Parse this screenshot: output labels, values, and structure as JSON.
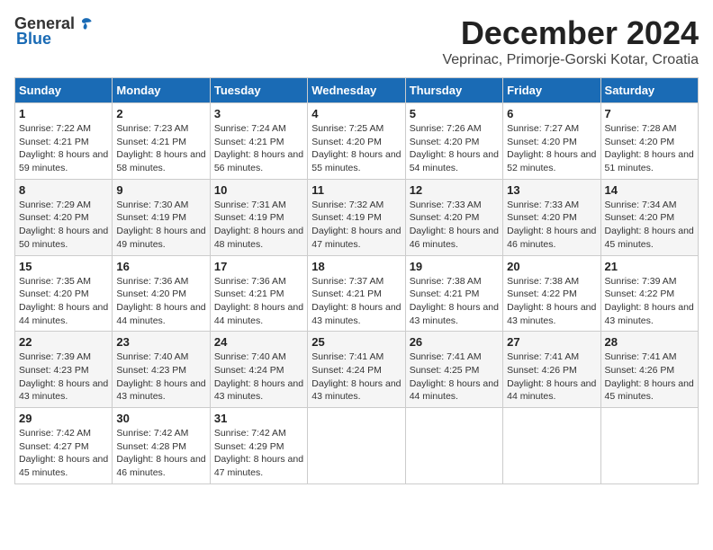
{
  "logo": {
    "general": "General",
    "blue": "Blue"
  },
  "title": "December 2024",
  "subtitle": "Veprinac, Primorje-Gorski Kotar, Croatia",
  "weekdays": [
    "Sunday",
    "Monday",
    "Tuesday",
    "Wednesday",
    "Thursday",
    "Friday",
    "Saturday"
  ],
  "weeks": [
    [
      {
        "day": "1",
        "sunrise": "7:22 AM",
        "sunset": "4:21 PM",
        "daylight": "8 hours and 59 minutes."
      },
      {
        "day": "2",
        "sunrise": "7:23 AM",
        "sunset": "4:21 PM",
        "daylight": "8 hours and 58 minutes."
      },
      {
        "day": "3",
        "sunrise": "7:24 AM",
        "sunset": "4:21 PM",
        "daylight": "8 hours and 56 minutes."
      },
      {
        "day": "4",
        "sunrise": "7:25 AM",
        "sunset": "4:20 PM",
        "daylight": "8 hours and 55 minutes."
      },
      {
        "day": "5",
        "sunrise": "7:26 AM",
        "sunset": "4:20 PM",
        "daylight": "8 hours and 54 minutes."
      },
      {
        "day": "6",
        "sunrise": "7:27 AM",
        "sunset": "4:20 PM",
        "daylight": "8 hours and 52 minutes."
      },
      {
        "day": "7",
        "sunrise": "7:28 AM",
        "sunset": "4:20 PM",
        "daylight": "8 hours and 51 minutes."
      }
    ],
    [
      {
        "day": "8",
        "sunrise": "7:29 AM",
        "sunset": "4:20 PM",
        "daylight": "8 hours and 50 minutes."
      },
      {
        "day": "9",
        "sunrise": "7:30 AM",
        "sunset": "4:19 PM",
        "daylight": "8 hours and 49 minutes."
      },
      {
        "day": "10",
        "sunrise": "7:31 AM",
        "sunset": "4:19 PM",
        "daylight": "8 hours and 48 minutes."
      },
      {
        "day": "11",
        "sunrise": "7:32 AM",
        "sunset": "4:19 PM",
        "daylight": "8 hours and 47 minutes."
      },
      {
        "day": "12",
        "sunrise": "7:33 AM",
        "sunset": "4:20 PM",
        "daylight": "8 hours and 46 minutes."
      },
      {
        "day": "13",
        "sunrise": "7:33 AM",
        "sunset": "4:20 PM",
        "daylight": "8 hours and 46 minutes."
      },
      {
        "day": "14",
        "sunrise": "7:34 AM",
        "sunset": "4:20 PM",
        "daylight": "8 hours and 45 minutes."
      }
    ],
    [
      {
        "day": "15",
        "sunrise": "7:35 AM",
        "sunset": "4:20 PM",
        "daylight": "8 hours and 44 minutes."
      },
      {
        "day": "16",
        "sunrise": "7:36 AM",
        "sunset": "4:20 PM",
        "daylight": "8 hours and 44 minutes."
      },
      {
        "day": "17",
        "sunrise": "7:36 AM",
        "sunset": "4:21 PM",
        "daylight": "8 hours and 44 minutes."
      },
      {
        "day": "18",
        "sunrise": "7:37 AM",
        "sunset": "4:21 PM",
        "daylight": "8 hours and 43 minutes."
      },
      {
        "day": "19",
        "sunrise": "7:38 AM",
        "sunset": "4:21 PM",
        "daylight": "8 hours and 43 minutes."
      },
      {
        "day": "20",
        "sunrise": "7:38 AM",
        "sunset": "4:22 PM",
        "daylight": "8 hours and 43 minutes."
      },
      {
        "day": "21",
        "sunrise": "7:39 AM",
        "sunset": "4:22 PM",
        "daylight": "8 hours and 43 minutes."
      }
    ],
    [
      {
        "day": "22",
        "sunrise": "7:39 AM",
        "sunset": "4:23 PM",
        "daylight": "8 hours and 43 minutes."
      },
      {
        "day": "23",
        "sunrise": "7:40 AM",
        "sunset": "4:23 PM",
        "daylight": "8 hours and 43 minutes."
      },
      {
        "day": "24",
        "sunrise": "7:40 AM",
        "sunset": "4:24 PM",
        "daylight": "8 hours and 43 minutes."
      },
      {
        "day": "25",
        "sunrise": "7:41 AM",
        "sunset": "4:24 PM",
        "daylight": "8 hours and 43 minutes."
      },
      {
        "day": "26",
        "sunrise": "7:41 AM",
        "sunset": "4:25 PM",
        "daylight": "8 hours and 44 minutes."
      },
      {
        "day": "27",
        "sunrise": "7:41 AM",
        "sunset": "4:26 PM",
        "daylight": "8 hours and 44 minutes."
      },
      {
        "day": "28",
        "sunrise": "7:41 AM",
        "sunset": "4:26 PM",
        "daylight": "8 hours and 45 minutes."
      }
    ],
    [
      {
        "day": "29",
        "sunrise": "7:42 AM",
        "sunset": "4:27 PM",
        "daylight": "8 hours and 45 minutes."
      },
      {
        "day": "30",
        "sunrise": "7:42 AM",
        "sunset": "4:28 PM",
        "daylight": "8 hours and 46 minutes."
      },
      {
        "day": "31",
        "sunrise": "7:42 AM",
        "sunset": "4:29 PM",
        "daylight": "8 hours and 47 minutes."
      },
      null,
      null,
      null,
      null
    ]
  ]
}
